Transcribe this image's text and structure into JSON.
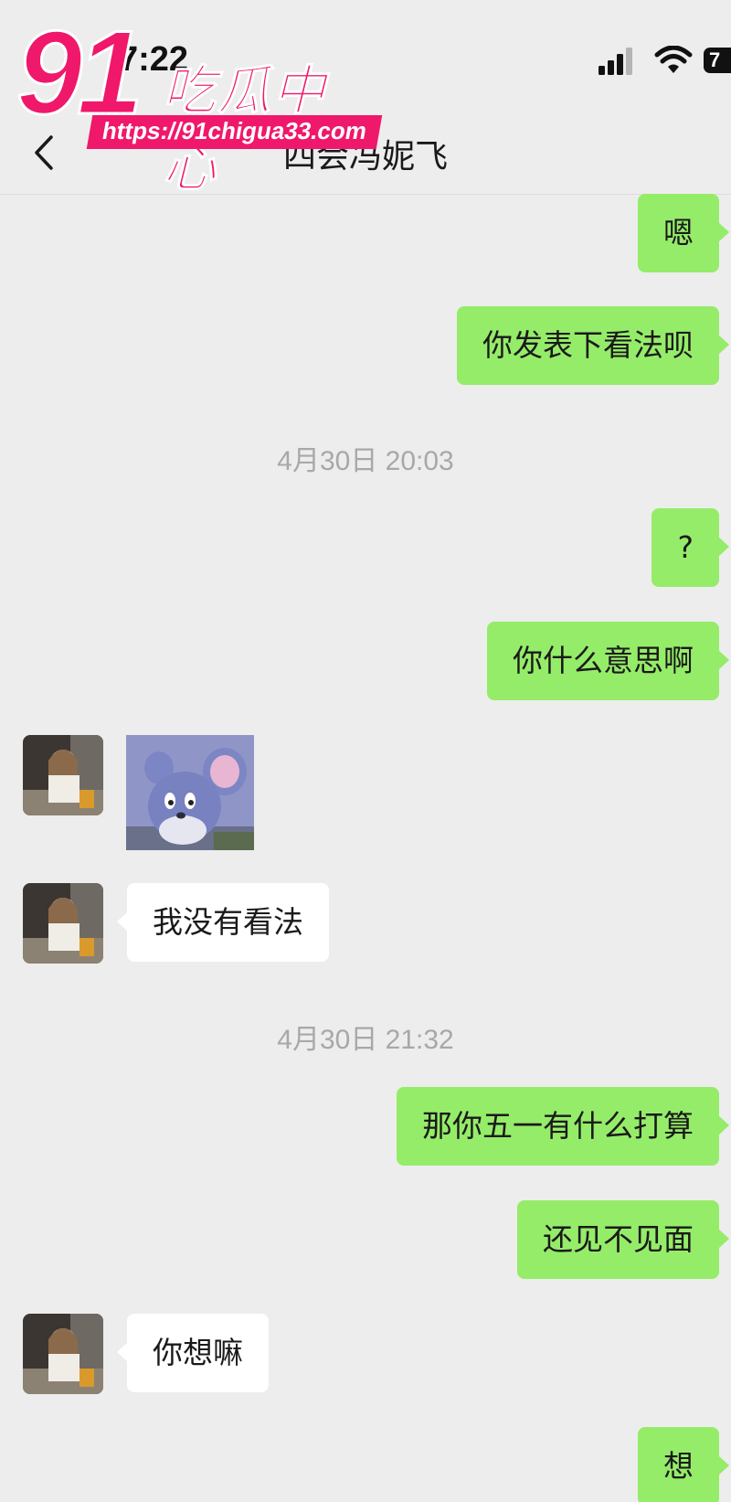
{
  "status_bar": {
    "time": "7:22",
    "battery": "7"
  },
  "watermark": {
    "number": "91",
    "name": "吃瓜中心",
    "url": "https://91chigua33.com"
  },
  "nav": {
    "title": "四会冯妮飞"
  },
  "messages": [
    {
      "type": "out",
      "text": "嗯"
    },
    {
      "type": "out",
      "text": "你发表下看法呗"
    },
    {
      "type": "time",
      "text": "4月30日 20:03"
    },
    {
      "type": "out",
      "text": "?"
    },
    {
      "type": "out",
      "text": "你什么意思啊"
    },
    {
      "type": "in_sticker",
      "sticker": "tuffy-mouse-sticker"
    },
    {
      "type": "in",
      "text": "我没有看法"
    },
    {
      "type": "time",
      "text": "4月30日 21:32"
    },
    {
      "type": "out",
      "text": "那你五一有什么打算"
    },
    {
      "type": "out",
      "text": "还见不见面"
    },
    {
      "type": "in",
      "text": "你想嘛"
    },
    {
      "type": "out",
      "text": "想"
    }
  ],
  "colors": {
    "background": "#ededed",
    "outgoing_bubble": "#95ec69",
    "incoming_bubble": "#ffffff",
    "watermark_pink": "#f0186a"
  }
}
